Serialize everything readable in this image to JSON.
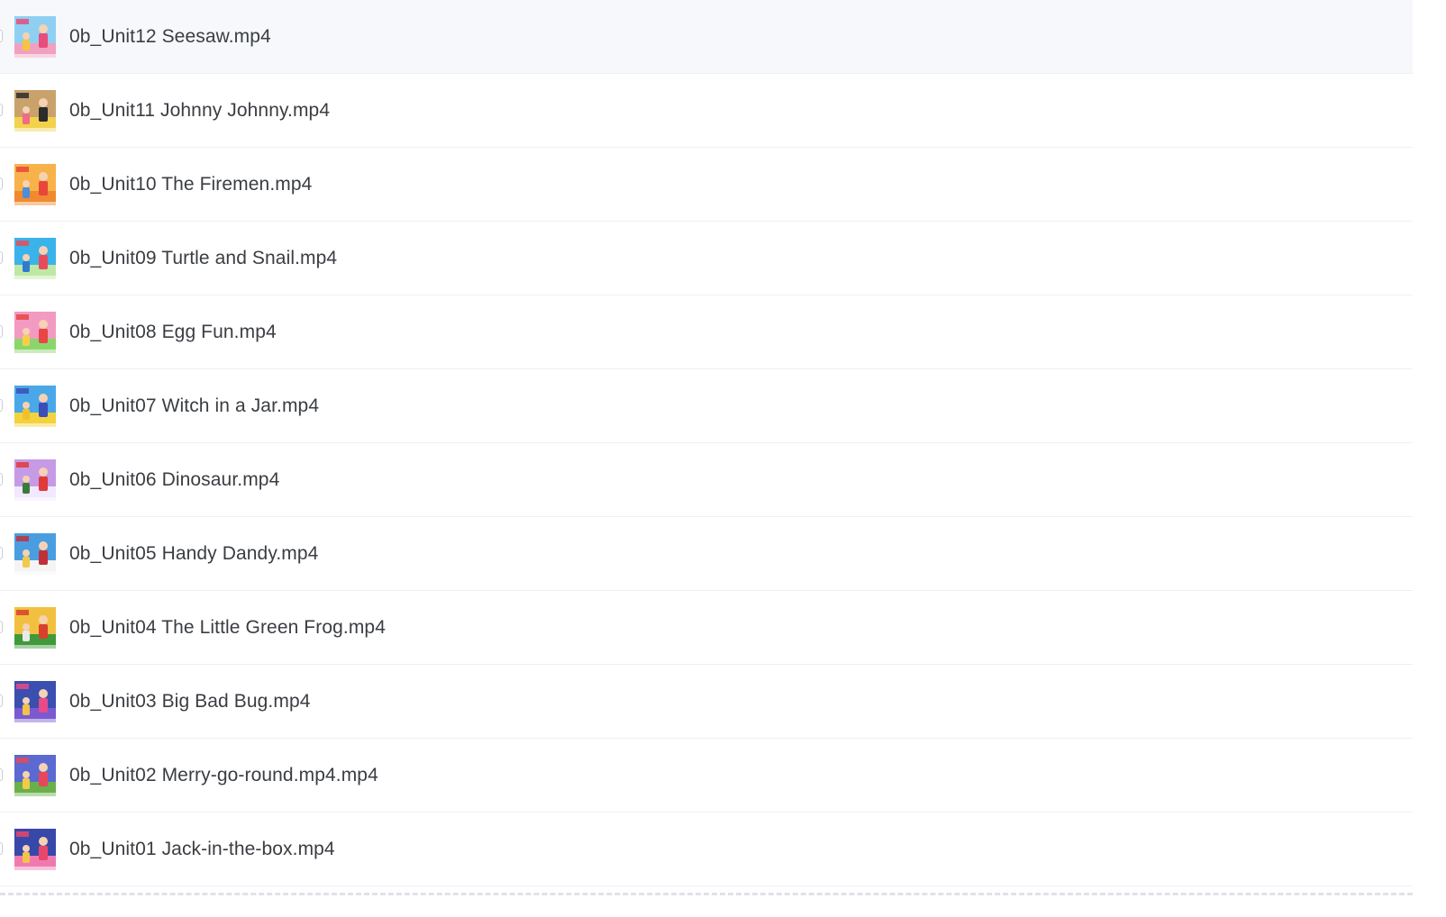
{
  "files": [
    {
      "name": "0b_Unit12 Seesaw.mp4",
      "thumb": {
        "sky": "#8fd0f2",
        "ground": "#f2a0c0",
        "accent": "#e74c7a",
        "figure": "#f4c542"
      }
    },
    {
      "name": "0b_Unit11 Johnny Johnny.mp4",
      "thumb": {
        "sky": "#c9a26b",
        "ground": "#f2d24a",
        "accent": "#2b2b2b",
        "figure": "#f06a8a"
      }
    },
    {
      "name": "0b_Unit10 The Firemen.mp4",
      "thumb": {
        "sky": "#f7b24a",
        "ground": "#f08a30",
        "accent": "#e8463a",
        "figure": "#4a8fd8"
      }
    },
    {
      "name": "0b_Unit09 Turtle and Snail.mp4",
      "thumb": {
        "sky": "#3ab3ea",
        "ground": "#bfe8a4",
        "accent": "#e84c5c",
        "figure": "#2e7bd0"
      }
    },
    {
      "name": "0b_Unit08 Egg Fun.mp4",
      "thumb": {
        "sky": "#f39ac2",
        "ground": "#8bd66a",
        "accent": "#e84545",
        "figure": "#f6d04a"
      }
    },
    {
      "name": "0b_Unit07 Witch in a Jar.mp4",
      "thumb": {
        "sky": "#4aa8e8",
        "ground": "#f3d23e",
        "accent": "#3a4fb8",
        "figure": "#f2c02c"
      }
    },
    {
      "name": "0b_Unit06 Dinosaur.mp4",
      "thumb": {
        "sky": "#c79ae6",
        "ground": "#f2e8ff",
        "accent": "#e03a3a",
        "figure": "#3a7a3a"
      }
    },
    {
      "name": "0b_Unit05 Handy Dandy.mp4",
      "thumb": {
        "sky": "#4a9ee0",
        "ground": "#f4f4f4",
        "accent": "#c0303a",
        "figure": "#f2c94a"
      }
    },
    {
      "name": "0b_Unit04 The Little Green Frog.mp4",
      "thumb": {
        "sky": "#f2c040",
        "ground": "#3f9a3a",
        "accent": "#d8402e",
        "figure": "#e9e9e9"
      }
    },
    {
      "name": "0b_Unit03 Big Bad Bug.mp4",
      "thumb": {
        "sky": "#3a4fb0",
        "ground": "#7a5ad0",
        "accent": "#e84a8a",
        "figure": "#f3c24a"
      }
    },
    {
      "name": "0b_Unit02 Merry-go-round.mp4.mp4",
      "thumb": {
        "sky": "#5a6ad0",
        "ground": "#6ab04a",
        "accent": "#e8465a",
        "figure": "#f3c94a"
      }
    },
    {
      "name": "0b_Unit01 Jack-in-the-box.mp4",
      "thumb": {
        "sky": "#3848a8",
        "ground": "#f07ab0",
        "accent": "#e8466a",
        "figure": "#f3c24a"
      }
    }
  ]
}
